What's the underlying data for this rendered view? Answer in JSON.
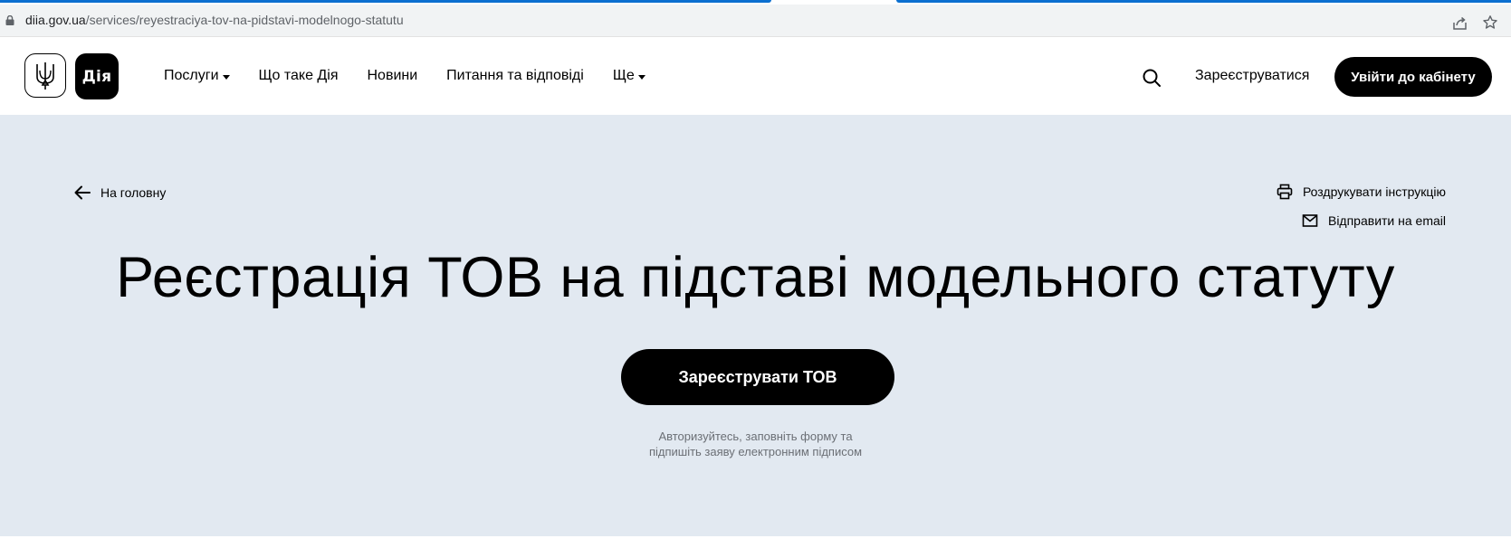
{
  "browser": {
    "url_host": "diia.gov.ua",
    "url_path": "/services/reyestraciya-tov-na-pidstavi-modelnogo-statutu"
  },
  "header": {
    "logo_text": "Дія",
    "nav": [
      {
        "label": "Послуги",
        "has_dropdown": true
      },
      {
        "label": "Що таке Дія",
        "has_dropdown": false
      },
      {
        "label": "Новини",
        "has_dropdown": false
      },
      {
        "label": "Питання та відповіді",
        "has_dropdown": false
      },
      {
        "label": "Ще",
        "has_dropdown": true
      }
    ],
    "register_label": "Зареєструватися",
    "login_label": "Увійти до кабінету"
  },
  "hero": {
    "back_label": "На головну",
    "print_label": "Роздрукувати інструкцію",
    "email_label": "Відправити на email",
    "title": "Реєстрація ТОВ на підставі модельного статуту",
    "cta_label": "Зареєструвати ТОВ",
    "hint_line1": "Авторизуйтесь, заповніть форму та",
    "hint_line2": "підпишіть заяву електронним підписом"
  },
  "colors": {
    "hero_background": "#e2e9f1",
    "primary_button": "#000000",
    "tab_accent": "#0b6fd0"
  }
}
